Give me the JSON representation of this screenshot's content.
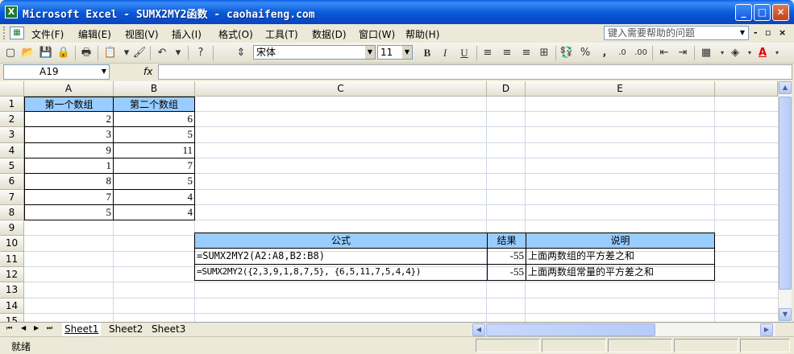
{
  "window": {
    "title": "Microsoft Excel - SUMX2MY2函数 - caohaifeng.com",
    "app_icon": "excel-icon",
    "buttons": [
      "minimize",
      "maximize",
      "close"
    ]
  },
  "menu": {
    "items": [
      "文件(F)",
      "编辑(E)",
      "视图(V)",
      "插入(I)",
      "格式(O)",
      "工具(T)",
      "数据(D)",
      "窗口(W)",
      "帮助(H)"
    ],
    "help_placeholder": "键入需要帮助的问题"
  },
  "toolbar": {
    "font": "宋体",
    "font_size": "11",
    "bold": "B",
    "italic": "I",
    "underline": "U",
    "percent": "%",
    "comma": ","
  },
  "formula_bar": {
    "name_box": "A19",
    "fx": "fx",
    "formula": ""
  },
  "grid": {
    "columns": [
      "A",
      "B",
      "C",
      "D",
      "E"
    ],
    "rows": [
      "1",
      "2",
      "3",
      "4",
      "5",
      "6",
      "7",
      "8",
      "9",
      "10",
      "11",
      "12",
      "13",
      "14",
      "15"
    ],
    "header_row": {
      "a": "第一个数组",
      "b": "第二个数组"
    },
    "data": [
      {
        "a": "2",
        "b": "6"
      },
      {
        "a": "3",
        "b": "5"
      },
      {
        "a": "9",
        "b": "11"
      },
      {
        "a": "1",
        "b": "7"
      },
      {
        "a": "8",
        "b": "5"
      },
      {
        "a": "7",
        "b": "4"
      },
      {
        "a": "5",
        "b": "4"
      }
    ],
    "table": {
      "headers": {
        "formula": "公式",
        "result": "结果",
        "description": "说明"
      },
      "rows": [
        {
          "formula": "=SUMX2MY2(A2:A8,B2:B8)",
          "result": "-55",
          "description": "上面两数组的平方差之和"
        },
        {
          "formula": "=SUMX2MY2({2,3,9,1,8,7,5}, {6,5,11,7,5,4,4})",
          "result": "-55",
          "description": "上面两数组常量的平方差之和"
        }
      ]
    }
  },
  "sheets": [
    "Sheet1",
    "Sheet2",
    "Sheet3"
  ],
  "status": {
    "text": "就绪"
  }
}
